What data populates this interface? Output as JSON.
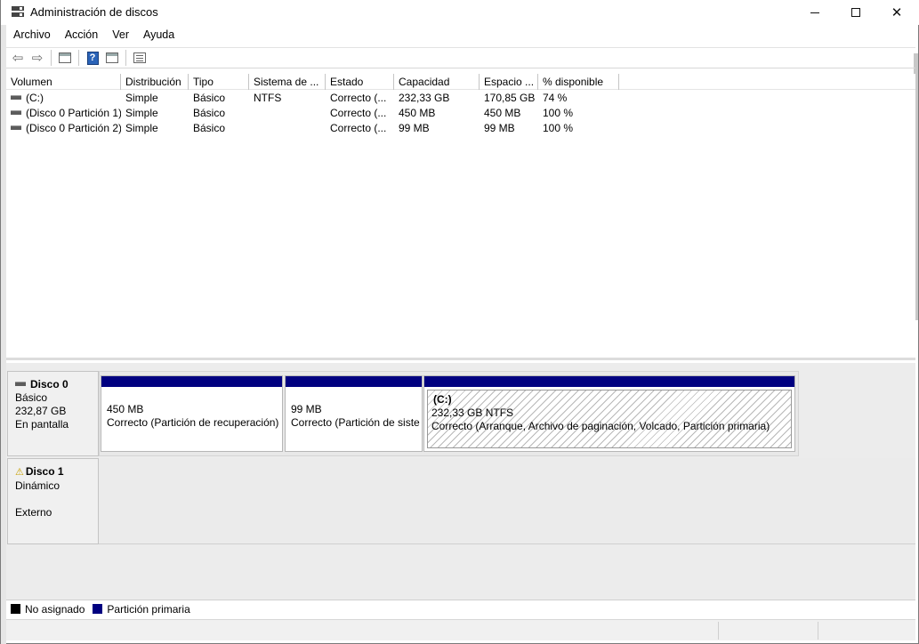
{
  "window": {
    "title": "Administración de discos"
  },
  "menu": [
    "Archivo",
    "Acción",
    "Ver",
    "Ayuda"
  ],
  "toolbar_icons": [
    "back-arrow-icon",
    "forward-arrow-icon",
    "console-tree-icon",
    "help-icon",
    "details-view-icon",
    "properties-icon"
  ],
  "volume_list": {
    "columns": [
      "Volumen",
      "Distribución",
      "Tipo",
      "Sistema de ...",
      "Estado",
      "Capacidad",
      "Espacio ...",
      "% disponible"
    ],
    "rows": [
      [
        "(C:)",
        "Simple",
        "Básico",
        "NTFS",
        "Correcto (...",
        "232,33 GB",
        "170,85 GB",
        "74 %"
      ],
      [
        "(Disco 0 Partición 1)",
        "Simple",
        "Básico",
        "",
        "Correcto (...",
        "450 MB",
        "450 MB",
        "100 %"
      ],
      [
        "(Disco 0 Partición 2)",
        "Simple",
        "Básico",
        "",
        "Correcto (...",
        "99 MB",
        "99 MB",
        "100 %"
      ]
    ]
  },
  "disks": [
    {
      "name": "Disco 0",
      "type": "Básico",
      "size": "232,87 GB",
      "status": "En pantalla",
      "partitions": [
        {
          "size": "450 MB",
          "status": "Correcto (Partición de recuperación)"
        },
        {
          "size": "99 MB",
          "status": "Correcto (Partición de siste"
        },
        {
          "label": "(C:)",
          "size": "232,33 GB NTFS",
          "status": "Correcto (Arranque, Archivo de paginación, Volcado, Partición primaria)"
        }
      ]
    },
    {
      "name": "Disco 1",
      "type": "Dinámico",
      "status": "Externo"
    }
  ],
  "legend": [
    {
      "label": "No asignado",
      "color": "#000000"
    },
    {
      "label": "Partición primaria",
      "color": "#000080"
    }
  ],
  "colors": {
    "primary_partition": "#000080",
    "unallocated": "#000000"
  }
}
